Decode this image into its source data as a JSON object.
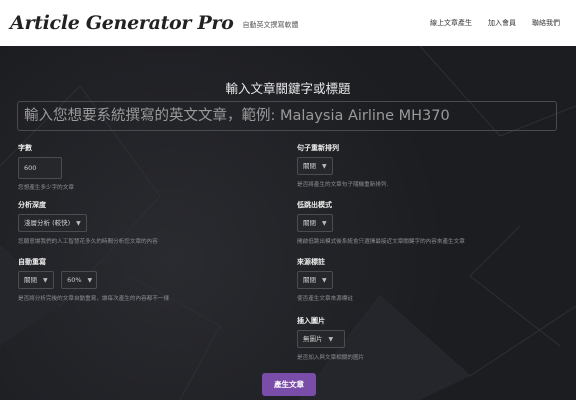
{
  "nav": {
    "brand": "Article Generator Pro",
    "tagline": "自動英文撰寫軟體",
    "links": [
      "線上文章產生",
      "加入會員",
      "聯絡我們"
    ]
  },
  "form": {
    "heading": "輸入文章關鍵字或標題",
    "keyword_placeholder": "輸入您想要系統撰寫的英文文章，範例: Malaysia Airline MH370",
    "word_count": {
      "label": "字數",
      "value": "600",
      "help": "您想產生多少字的文章"
    },
    "analysis_depth": {
      "label": "分析深度",
      "value": "淺層分析 (較快)",
      "help": "您願意讓我們的人工智慧花多久的時間分析您文章的內容"
    },
    "auto_rewrite": {
      "label": "自動重寫",
      "value": "關閉",
      "percent": "60%",
      "help": "是否將分析完後的文章自動重寫，讓每次產生的內容都不一樣"
    },
    "sentence_shuffle": {
      "label": "句子重新排列",
      "value": "關閉",
      "help": "是否將產生的文章句子隨機重新排列."
    },
    "low_bounce": {
      "label": "低跳出模式",
      "value": "關閉",
      "help": "開啟低跳出模式後系統會只選擇最接近文章關鍵字的內容來產生文章"
    },
    "source_tag": {
      "label": "來源標註",
      "value": "關閉",
      "help": "使否產生文章來源標註"
    },
    "insert_image": {
      "label": "插入圖片",
      "value": "無圖片",
      "help": "是否加入與文章相關的圖片"
    },
    "submit_label": "產生文章"
  },
  "colors": {
    "accent": "#7a4ea8",
    "navbar": "#ffffff",
    "background": "#1e1f23"
  }
}
